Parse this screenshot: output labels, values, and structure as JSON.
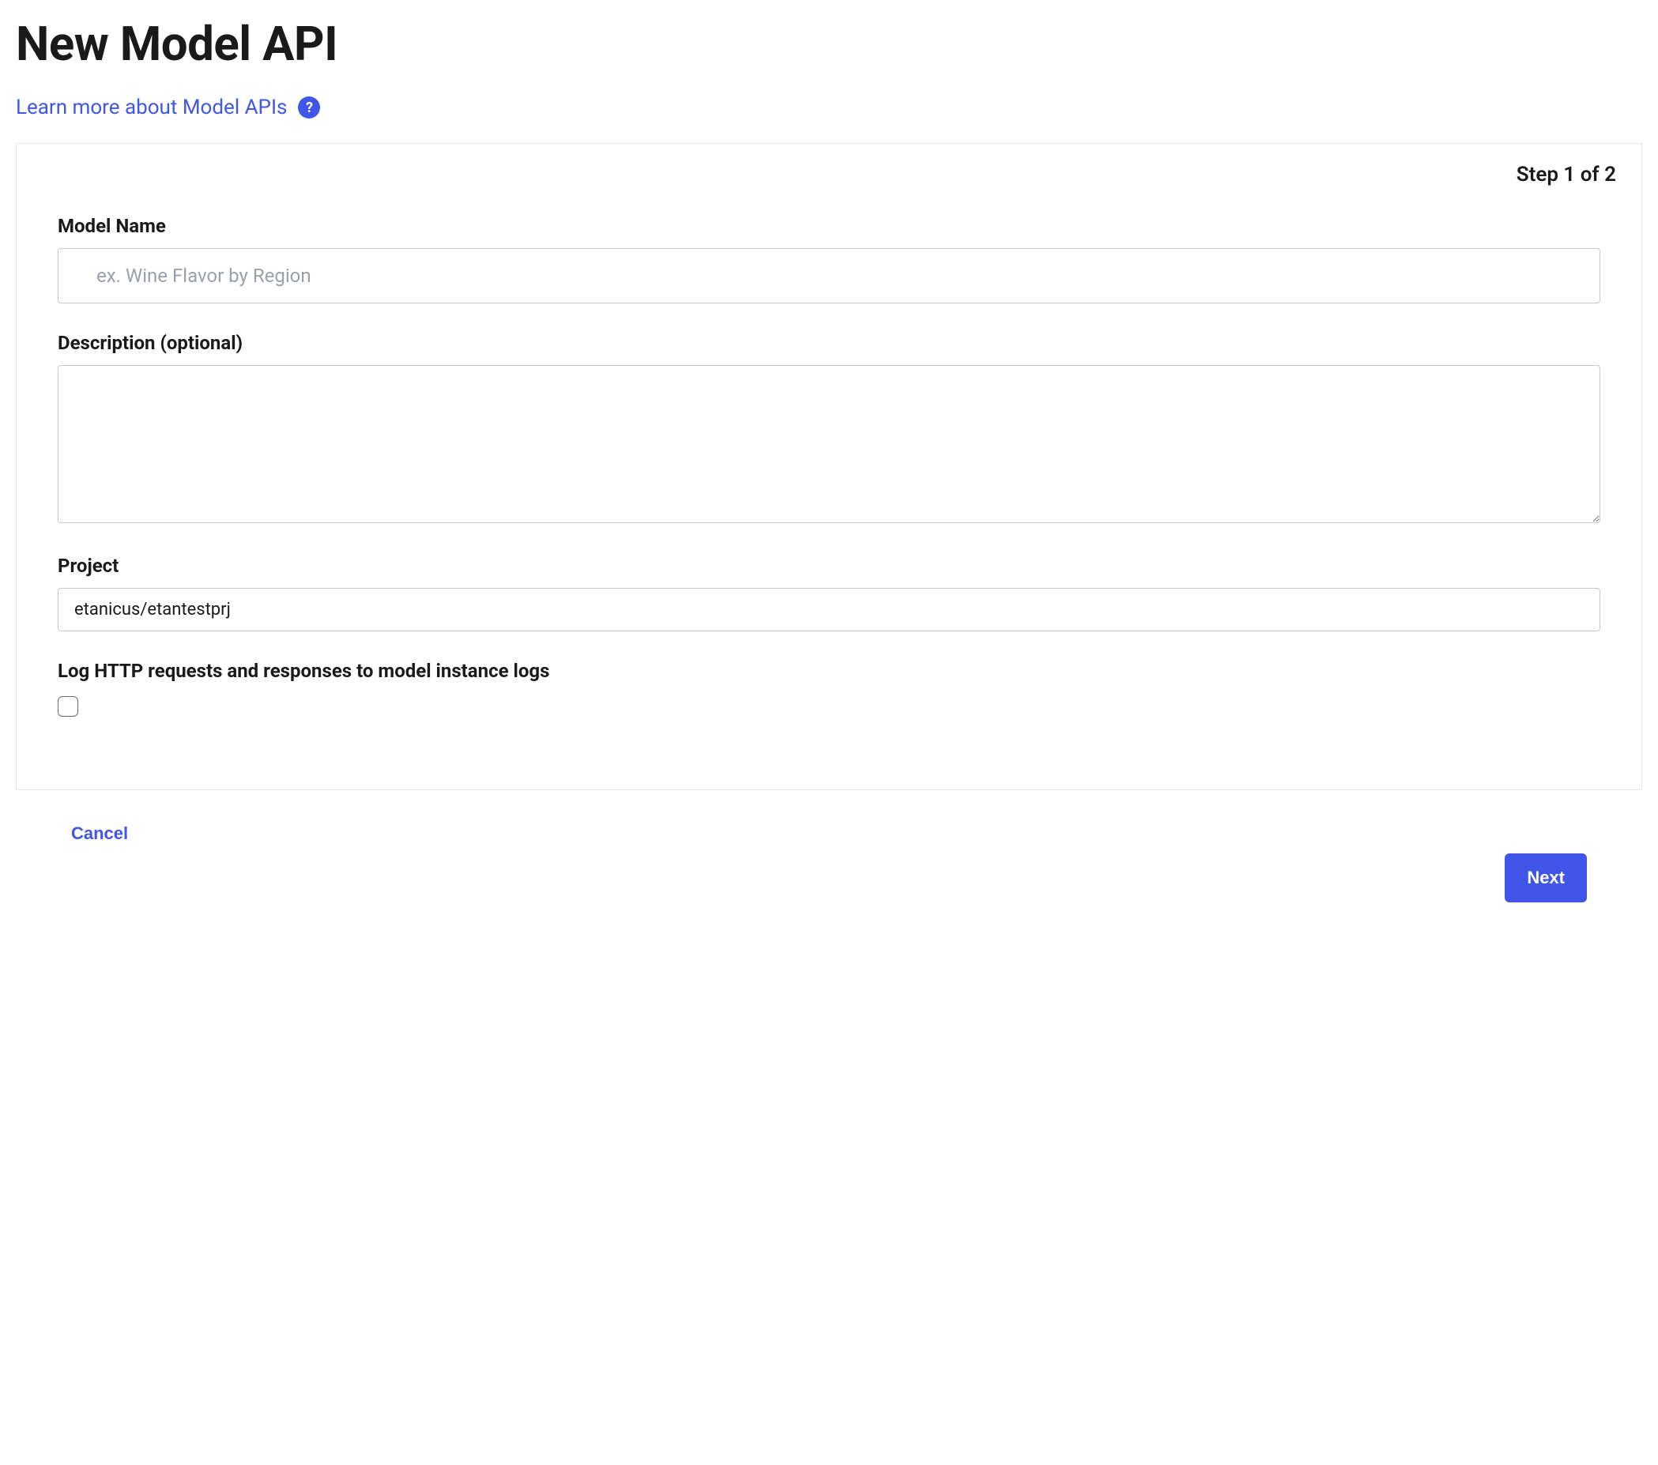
{
  "header": {
    "title": "New Model API",
    "learn_more_text": "Learn more about Model APIs",
    "help_icon_char": "?"
  },
  "step": {
    "label": "Step 1 of 2"
  },
  "form": {
    "model_name": {
      "label": "Model Name",
      "placeholder": "ex. Wine Flavor by Region",
      "value": ""
    },
    "description": {
      "label": "Description (optional)",
      "value": ""
    },
    "project": {
      "label": "Project",
      "value": "etanicus/etantestprj"
    },
    "log_http": {
      "label": "Log HTTP requests and responses to model instance logs",
      "checked": false
    }
  },
  "actions": {
    "cancel": "Cancel",
    "next": "Next"
  }
}
